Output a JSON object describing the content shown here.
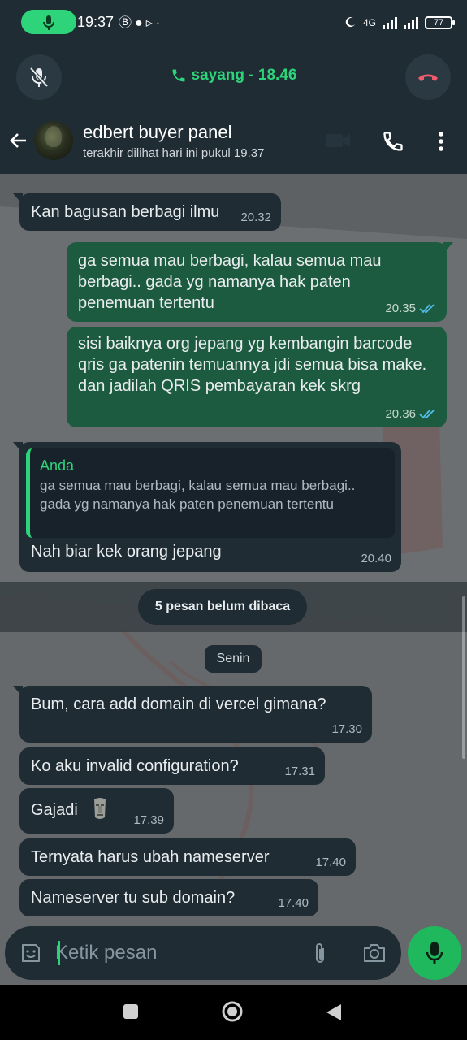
{
  "status_bar": {
    "time": "19:37",
    "notif_icons": [
      "b-icon",
      "circle-icon",
      "play-icon",
      "dot-icon"
    ],
    "network": "4G",
    "battery": "77"
  },
  "call": {
    "title": "sayang - 18.46",
    "accent": "#2ed47a",
    "end_color": "#f15c6d"
  },
  "header": {
    "name": "edbert buyer panel",
    "status": "terakhir dilihat hari ini pukul 19.37"
  },
  "messages": [
    {
      "dir": "in",
      "text": "Kan bagusan berbagi ilmu",
      "time": "20.32"
    },
    {
      "dir": "out",
      "text": "ga semua mau berbagi, kalau semua mau berbagi.. gada yg namanya hak paten penemuan tertentu",
      "time": "20.35",
      "read": true
    },
    {
      "dir": "out",
      "text": "sisi baiknya org jepang yg kembangin barcode qris ga patenin temuannya jdi semua bisa make. dan jadilah QRIS pembayaran kek skrg",
      "time": "20.36",
      "read": true
    },
    {
      "dir": "in",
      "quote_author": "Anda",
      "quote_text": "ga semua mau berbagi, kalau semua mau berbagi.. gada yg namanya hak paten penemuan tertentu",
      "text": "Nah biar kek orang jepang",
      "time": "20.40"
    },
    {
      "dir": "in",
      "text": "Bum, cara add domain di vercel gimana?",
      "time": "17.30"
    },
    {
      "dir": "in",
      "text": "Ko aku invalid configuration?",
      "time": "17.31"
    },
    {
      "dir": "in",
      "text": "Gajadi",
      "emoji": "moai-emoji",
      "time": "17.39"
    },
    {
      "dir": "in",
      "text": "Ternyata harus ubah nameserver",
      "time": "17.40"
    },
    {
      "dir": "in",
      "text": "Nameserver tu sub domain?",
      "time": "17.40"
    }
  ],
  "unread_banner": "5 pesan belum dibaca",
  "date_chip": "Senin",
  "composer": {
    "placeholder": "Ketik pesan"
  },
  "colors": {
    "incoming": "#1f2c34",
    "outgoing": "#1d5b40",
    "read_ticks": "#53bdeb",
    "mic": "#20b85c"
  }
}
